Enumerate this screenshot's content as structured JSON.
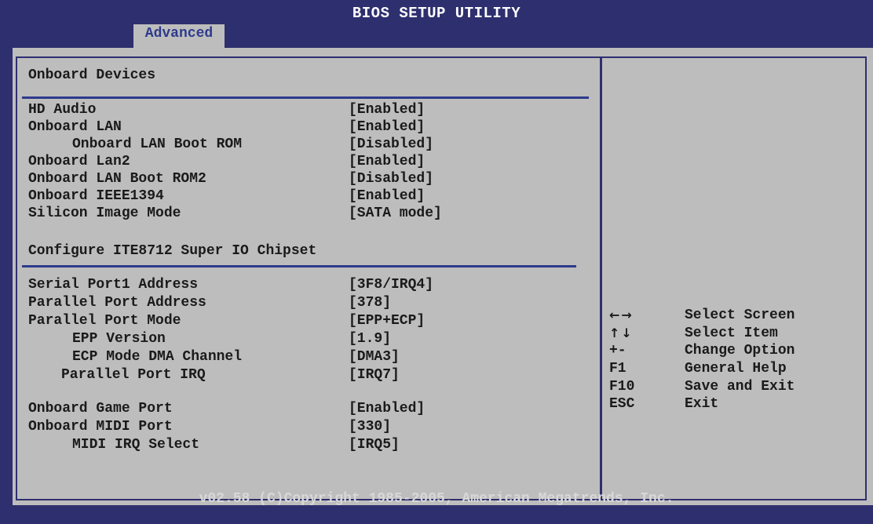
{
  "header": {
    "title": "BIOS SETUP UTILITY",
    "active_tab": "Advanced"
  },
  "section1": {
    "title": "Onboard Devices"
  },
  "section2": {
    "title": "Configure ITE8712 Super IO Chipset"
  },
  "settings": [
    {
      "label": "HD Audio",
      "value": "[Enabled]"
    },
    {
      "label": "Onboard LAN",
      "value": "[Enabled]"
    },
    {
      "label": "Onboard LAN Boot ROM",
      "value": "[Disabled]"
    },
    {
      "label": "Onboard Lan2",
      "value": "[Enabled]"
    },
    {
      "label": "Onboard LAN Boot ROM2",
      "value": "[Disabled]"
    },
    {
      "label": "Onboard IEEE1394",
      "value": "[Enabled]"
    },
    {
      "label": "Silicon Image Mode",
      "value": "[SATA mode]"
    },
    {
      "label": "Serial Port1 Address",
      "value": "[3F8/IRQ4]"
    },
    {
      "label": "Parallel Port Address",
      "value": "[378]"
    },
    {
      "label": "Parallel Port Mode",
      "value": "[EPP+ECP]"
    },
    {
      "label": "EPP Version",
      "value": "[1.9]"
    },
    {
      "label": "ECP Mode DMA Channel",
      "value": "[DMA3]"
    },
    {
      "label": "Parallel Port IRQ",
      "value": "[IRQ7]"
    },
    {
      "label": "Onboard Game Port",
      "value": "[Enabled]"
    },
    {
      "label": "Onboard MIDI Port",
      "value": "[330]"
    },
    {
      "label": "MIDI IRQ Select",
      "value": "[IRQ5]"
    }
  ],
  "help": [
    {
      "key": "←→",
      "icon": "left-right-arrows-icon",
      "desc": "Select Screen"
    },
    {
      "key": "↑↓",
      "icon": "up-down-arrows-icon",
      "desc": "Select Item"
    },
    {
      "key": "+-",
      "desc": "Change Option"
    },
    {
      "key": "F1",
      "desc": "General Help"
    },
    {
      "key": "F10",
      "desc": "Save and Exit"
    },
    {
      "key": "ESC",
      "desc": "Exit"
    }
  ],
  "footer": {
    "text": "v02.58 (C)Copyright 1985-2005, American Megatrends, Inc."
  },
  "colors": {
    "background": "#2e2f6e",
    "panel": "#bdbdbd",
    "accent": "#2e3a8c"
  }
}
